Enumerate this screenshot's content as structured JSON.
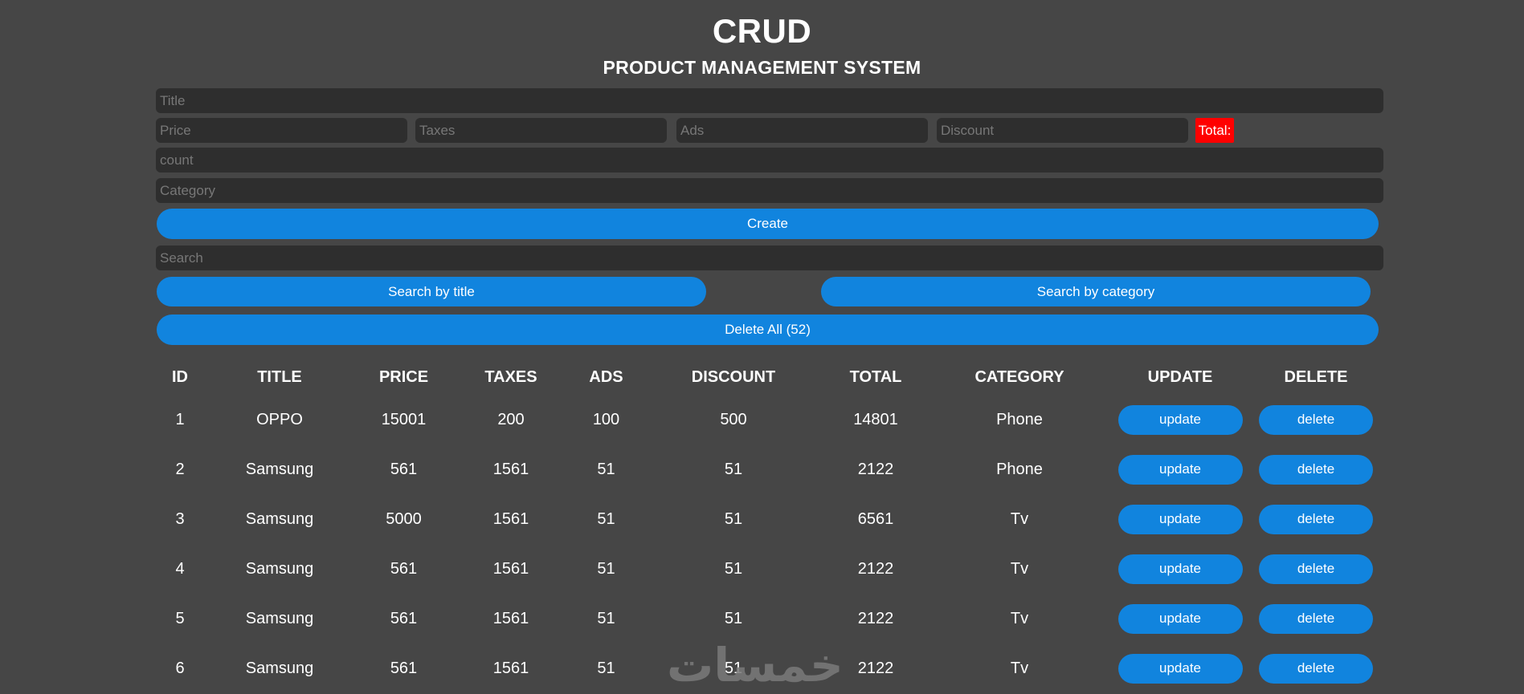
{
  "header": {
    "title": "CRUD",
    "subtitle": "PRODUCT MANAGEMENT SYSTEM"
  },
  "form": {
    "title_placeholder": "Title",
    "price_placeholder": "Price",
    "taxes_placeholder": "Taxes",
    "ads_placeholder": "Ads",
    "discount_placeholder": "Discount",
    "total_label": "Total:",
    "count_placeholder": "count",
    "category_placeholder": "Category",
    "create_label": "Create"
  },
  "search": {
    "placeholder": "Search",
    "by_title_label": "Search by title",
    "by_category_label": "Search by category",
    "delete_all_label": "Delete All (52)"
  },
  "table": {
    "headers": [
      "ID",
      "TITLE",
      "PRICE",
      "TAXES",
      "ADS",
      "DISCOUNT",
      "TOTAL",
      "CATEGORY",
      "UPDATE",
      "DELETE"
    ],
    "update_label": "update",
    "delete_label": "delete",
    "rows": [
      {
        "id": "1",
        "title": "OPPO",
        "price": "15001",
        "taxes": "200",
        "ads": "100",
        "discount": "500",
        "total": "14801",
        "category": "Phone"
      },
      {
        "id": "2",
        "title": "Samsung",
        "price": "561",
        "taxes": "1561",
        "ads": "51",
        "discount": "51",
        "total": "2122",
        "category": "Phone"
      },
      {
        "id": "3",
        "title": "Samsung",
        "price": "5000",
        "taxes": "1561",
        "ads": "51",
        "discount": "51",
        "total": "6561",
        "category": "Tv"
      },
      {
        "id": "4",
        "title": "Samsung",
        "price": "561",
        "taxes": "1561",
        "ads": "51",
        "discount": "51",
        "total": "2122",
        "category": "Tv"
      },
      {
        "id": "5",
        "title": "Samsung",
        "price": "561",
        "taxes": "1561",
        "ads": "51",
        "discount": "51",
        "total": "2122",
        "category": "Tv"
      },
      {
        "id": "6",
        "title": "Samsung",
        "price": "561",
        "taxes": "1561",
        "ads": "51",
        "discount": "51",
        "total": "2122",
        "category": "Tv"
      }
    ]
  },
  "watermark": {
    "text": "خمسات"
  },
  "colors": {
    "background": "#464646",
    "input": "#2e2e2e",
    "accent": "#1184de",
    "total_badge": "#ff0000"
  }
}
